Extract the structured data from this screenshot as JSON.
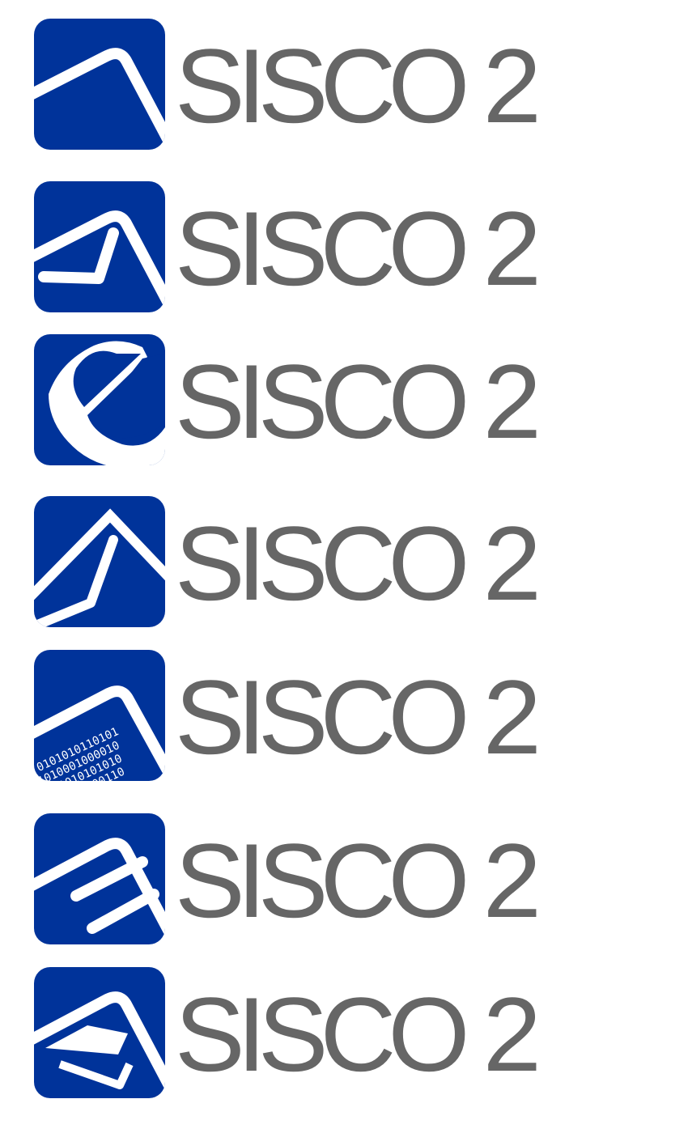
{
  "brand": {
    "icon_color": "#00339a",
    "wordmark_color": "#666666"
  },
  "logos": [
    {
      "wordmark": "SISCO 2",
      "icon": "roof-arch-icon"
    },
    {
      "wordmark": "SISCO 2",
      "icon": "roof-check-icon"
    },
    {
      "wordmark": "SISCO 2",
      "icon": "e-letter-icon"
    },
    {
      "wordmark": "SISCO 2",
      "icon": "house-chart-icon"
    },
    {
      "wordmark": "SISCO 2",
      "icon": "roof-binary-data-icon"
    },
    {
      "wordmark": "SISCO 2",
      "icon": "roof-document-lines-icon"
    },
    {
      "wordmark": "SISCO 2",
      "icon": "roof-envelope-icon"
    }
  ]
}
